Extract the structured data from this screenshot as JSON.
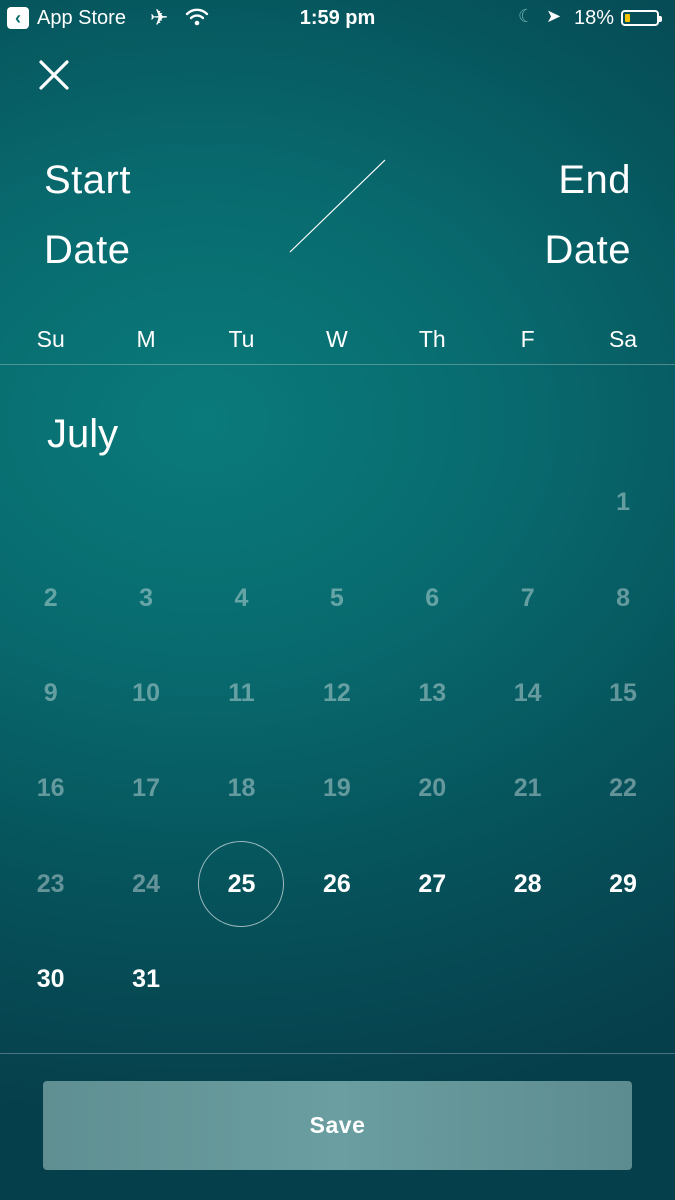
{
  "status_bar": {
    "back_app": "App Store",
    "time": "1:59 pm",
    "battery": "18%",
    "battery_level": 0.18,
    "icons": [
      "back-icon",
      "airplane-icon",
      "wifi-icon",
      "moon-icon",
      "location-arrow-icon",
      "battery-icon"
    ]
  },
  "header": {
    "close_icon": "close-icon",
    "start_label": [
      "Start",
      "Date"
    ],
    "end_label": [
      "End",
      "Date"
    ]
  },
  "weekdays": [
    "Su",
    "M",
    "Tu",
    "W",
    "Th",
    "F",
    "Sa"
  ],
  "calendar": {
    "month": "July",
    "first_weekday_index": 6,
    "days": [
      "1",
      "2",
      "3",
      "4",
      "5",
      "6",
      "7",
      "8",
      "9",
      "10",
      "11",
      "12",
      "13",
      "14",
      "15",
      "16",
      "17",
      "18",
      "19",
      "20",
      "21",
      "22",
      "23",
      "24",
      "25",
      "26",
      "27",
      "28",
      "29",
      "30",
      "31"
    ],
    "today": "25",
    "first_enabled": 25
  },
  "footer": {
    "save_label": "Save"
  },
  "colors": {
    "background": "#086a6e",
    "disabled_day": "rgba(255,255,255,0.38)",
    "enabled_day": "#ffffff",
    "button": "#6a9ea0",
    "battery_fill": "#f5c400"
  }
}
